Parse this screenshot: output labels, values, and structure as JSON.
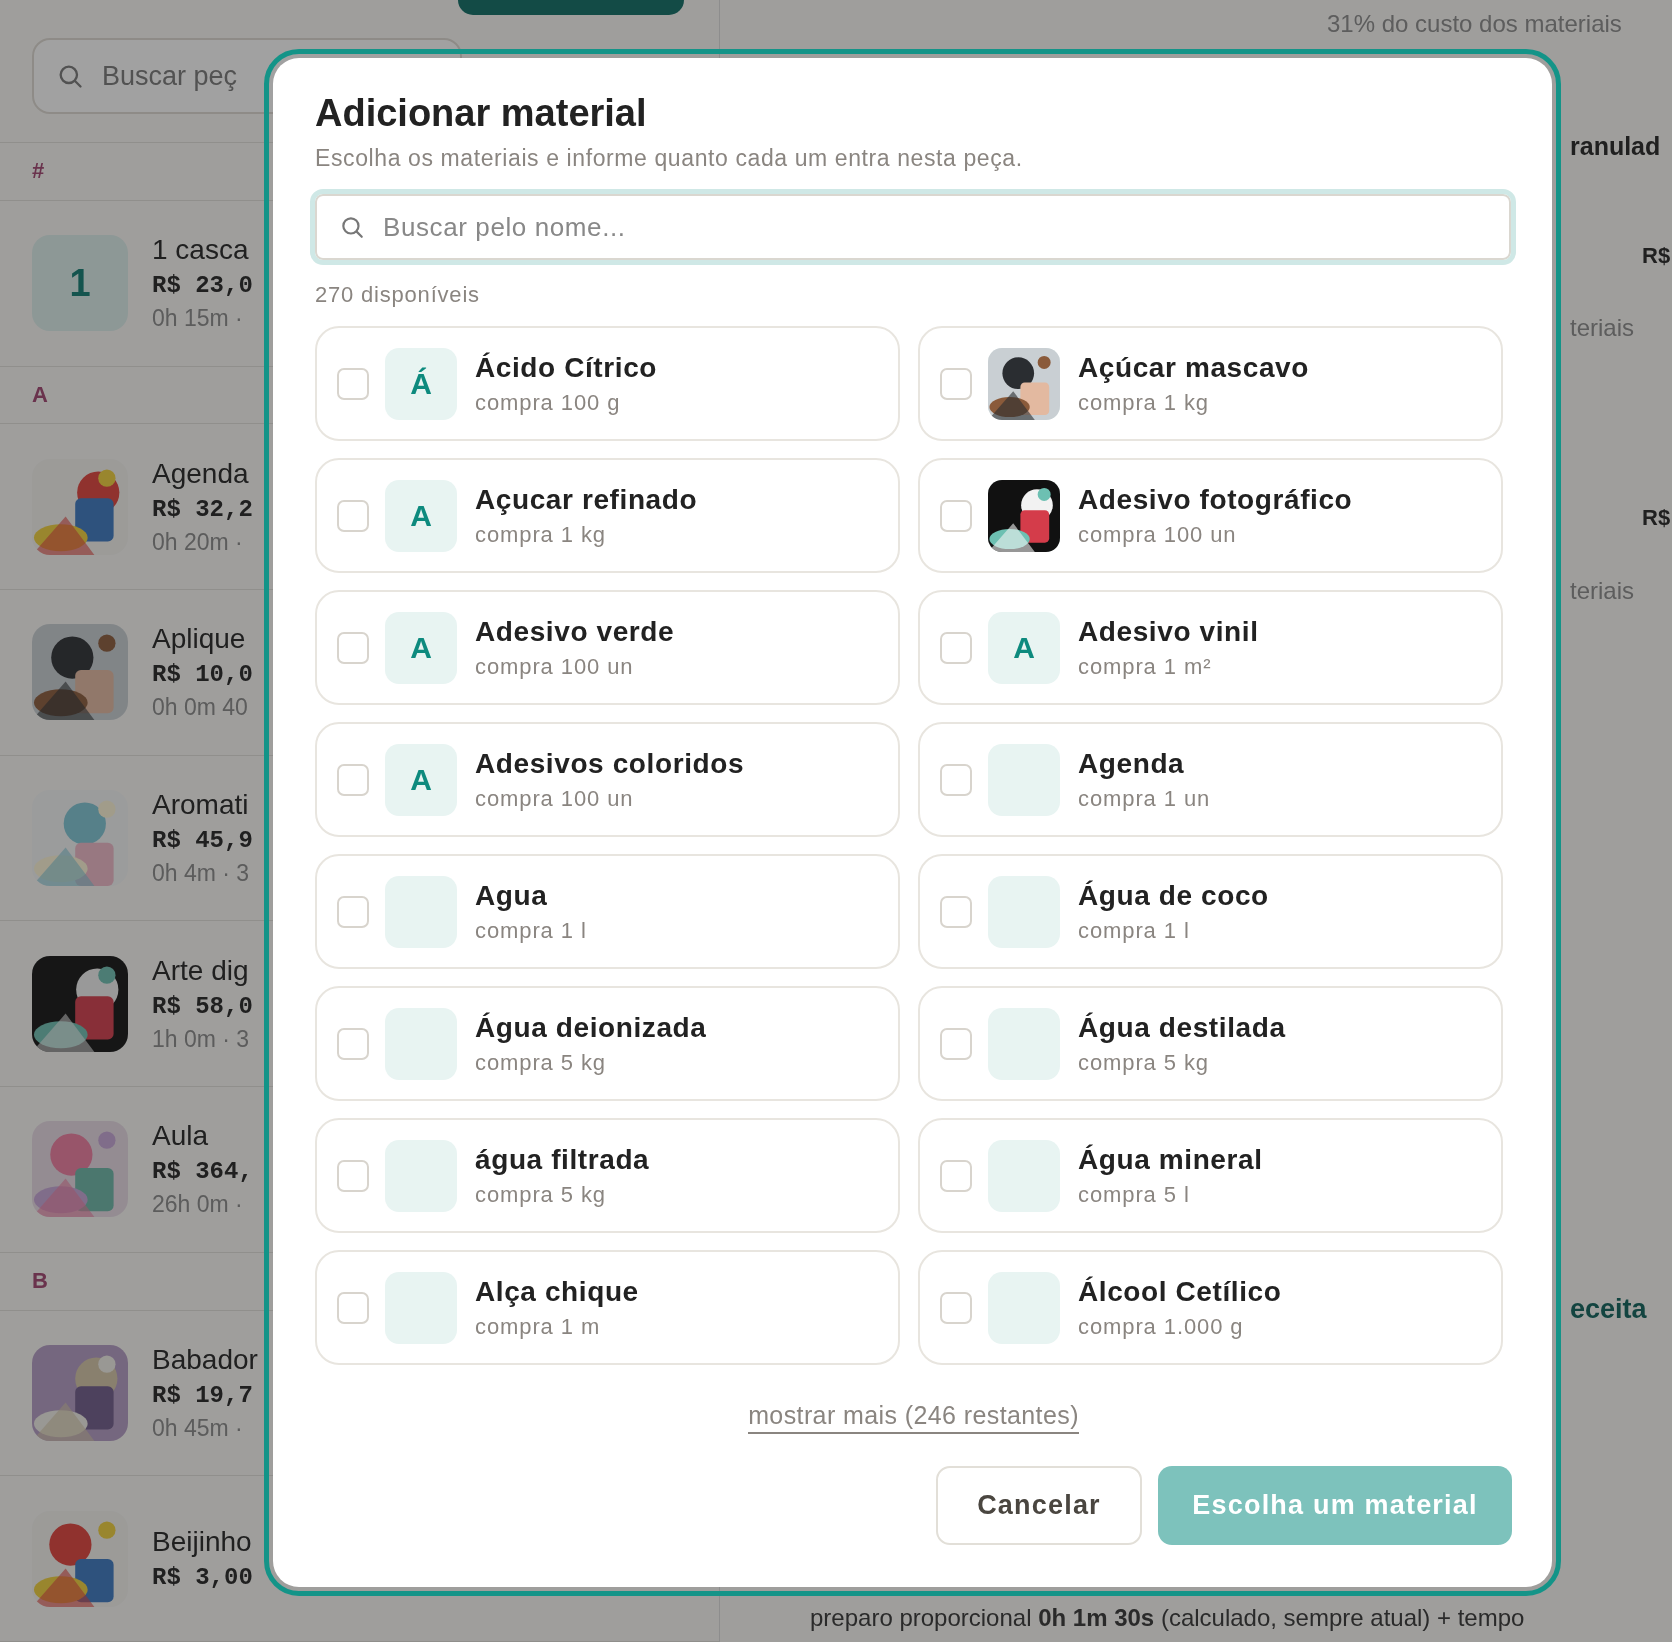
{
  "background": {
    "search": {
      "placeholder": "Buscar peç"
    },
    "list": [
      {
        "kind": "section",
        "label": "#"
      },
      {
        "kind": "item",
        "thumb": {
          "kind": "letter",
          "text": "1"
        },
        "name": "1 casca",
        "price": "R$ 23,0",
        "meta": "0h 15m ·"
      },
      {
        "kind": "section",
        "label": "A"
      },
      {
        "kind": "item",
        "name": "Agenda",
        "price": "R$ 32,2",
        "meta": "0h 20m ·"
      },
      {
        "kind": "item",
        "name": "Aplique",
        "price": "R$ 10,0",
        "meta": "0h 0m 40"
      },
      {
        "kind": "item",
        "name": "Aromati",
        "price": "R$ 45,9",
        "meta": "0h 4m · 3"
      },
      {
        "kind": "item",
        "name": "Arte dig",
        "price": "R$ 58,0",
        "meta": "1h 0m · 3"
      },
      {
        "kind": "item",
        "name": "Aula",
        "price": "R$ 364,",
        "meta": "26h 0m ·"
      },
      {
        "kind": "section",
        "label": "B"
      },
      {
        "kind": "item",
        "name": "Babador",
        "price": "R$ 19,7",
        "meta": "0h 45m ·"
      },
      {
        "kind": "item",
        "name": "Beijinho",
        "price": "R$ 3,00"
      }
    ],
    "side": [
      {
        "kind": "muted",
        "text": "31% do custo dos materiais"
      },
      {
        "kind": "title",
        "text": "ranulad"
      },
      {
        "kind": "strong",
        "text": "R$"
      },
      {
        "kind": "muted",
        "text": "teriais"
      },
      {
        "kind": "strong",
        "text": "R$"
      },
      {
        "kind": "muted",
        "text": "teriais"
      },
      {
        "kind": "link",
        "text": "eceita"
      }
    ],
    "footer_line": "preparo proporcional **0h 1m 30s** (calculado, sempre atual) + tempo"
  },
  "modal": {
    "title": "Adicionar material",
    "subtitle": "Escolha os materiais e informe quanto cada um entra nesta peça.",
    "search": {
      "placeholder": "Buscar pelo nome..."
    },
    "count": "270 disponíveis",
    "materials": [
      {
        "name": "Ácido Cítrico",
        "purchase": "compra 100 g",
        "checked": false,
        "thumb": {
          "kind": "letter",
          "text": "Á"
        }
      },
      {
        "name": "Açúcar mascavo",
        "purchase": "compra 1 kg",
        "checked": false
      },
      {
        "name": "Açucar refinado",
        "purchase": "compra 1 kg",
        "checked": false,
        "thumb": {
          "kind": "letter",
          "text": "A"
        }
      },
      {
        "name": "Adesivo fotográfico",
        "purchase": "compra 100 un",
        "checked": false
      },
      {
        "name": "Adesivo verde",
        "purchase": "compra 100 un",
        "checked": false,
        "thumb": {
          "kind": "letter",
          "text": "A"
        }
      },
      {
        "name": "Adesivo vinil",
        "purchase": "compra 1 m²",
        "checked": false,
        "thumb": {
          "kind": "letter",
          "text": "A"
        }
      },
      {
        "name": "Adesivos coloridos",
        "purchase": "compra 100 un",
        "checked": false,
        "thumb": {
          "kind": "letter",
          "text": "A"
        }
      },
      {
        "name": "Agenda",
        "purchase": "compra 1 un",
        "checked": false,
        "thumb": {
          "kind": "blank"
        }
      },
      {
        "name": "Agua",
        "purchase": "compra 1 l",
        "checked": false,
        "thumb": {
          "kind": "blank"
        }
      },
      {
        "name": "Água de coco",
        "purchase": "compra 1 l",
        "checked": false,
        "thumb": {
          "kind": "blank"
        }
      },
      {
        "name": "Água deionizada",
        "purchase": "compra 5 kg",
        "checked": false,
        "thumb": {
          "kind": "blank"
        }
      },
      {
        "name": "Água destilada",
        "purchase": "compra 5 kg",
        "checked": false,
        "thumb": {
          "kind": "blank"
        }
      },
      {
        "name": "água filtrada",
        "purchase": "compra 5 kg",
        "checked": false,
        "thumb": {
          "kind": "blank"
        }
      },
      {
        "name": "Água mineral",
        "purchase": "compra 5 l",
        "checked": false,
        "thumb": {
          "kind": "blank"
        }
      },
      {
        "name": "Alça chique",
        "purchase": "compra 1 m",
        "checked": false,
        "thumb": {
          "kind": "blank"
        }
      },
      {
        "name": "Álcool Cetílico",
        "purchase": "compra 1.000 g",
        "checked": false,
        "thumb": {
          "kind": "blank"
        }
      }
    ],
    "show_more": "mostrar mais (246 restantes)",
    "buttons": [
      {
        "kind": "secondary",
        "label": "Cancelar",
        "disabled": false
      },
      {
        "kind": "primary",
        "label": "Escolha um material",
        "disabled": true
      }
    ]
  }
}
